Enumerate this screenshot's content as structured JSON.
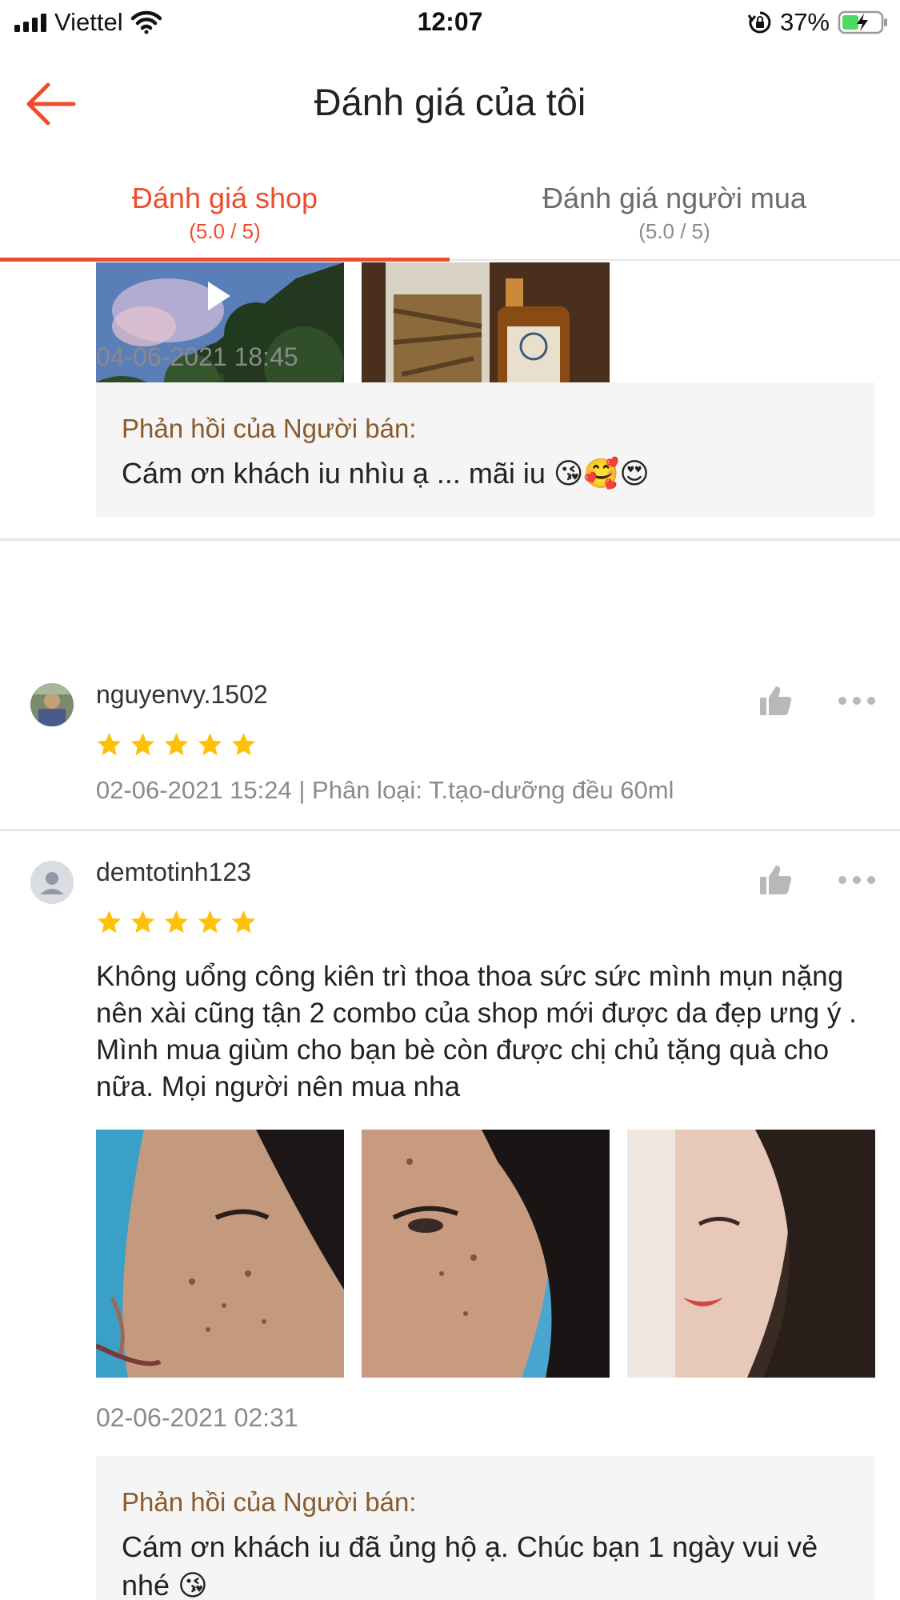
{
  "status_bar": {
    "carrier": "Viettel",
    "time": "12:07",
    "battery": "37%"
  },
  "header": {
    "title": "Đánh giá của tôi"
  },
  "tabs": [
    {
      "label": "Đánh giá shop",
      "score": "(5.0 / 5)",
      "active": true
    },
    {
      "label": "Đánh giá người mua",
      "score": "(5.0 / 5)",
      "active": false
    }
  ],
  "reviews": [
    {
      "date": "04-06-2021 18:45",
      "reply": {
        "title": "Phản hồi của Người bán:",
        "text": "Cám ơn khách iu nhìu ạ ... mãi iu 😘🥰😍"
      }
    },
    {
      "username": "nguyenvy.1502",
      "rating": 5,
      "meta": "02-06-2021 15:24 | Phân loại: T.tạo-dưỡng đều 60ml"
    },
    {
      "username": "demtotinh123",
      "rating": 5,
      "text": "Không uổng công kiên trì thoa thoa sức sức mình mụn nặng nên xài cũng tận 2 combo của shop mới được da đẹp ưng ý . Mình mua giùm cho bạn bè còn được chị chủ tặng quà cho nữa. Mọi người nên mua nha",
      "date": "02-06-2021 02:31",
      "reply": {
        "title": "Phản hồi của Người bán:",
        "text": "Cám ơn khách iu đã ủng hộ ạ. Chúc bạn 1 ngày vui vẻ nhé 😘"
      }
    }
  ],
  "colors": {
    "accent": "#ee4d2d",
    "star": "#ffc107",
    "reply_title": "#8a5a2b",
    "muted": "#8a8a8a"
  }
}
